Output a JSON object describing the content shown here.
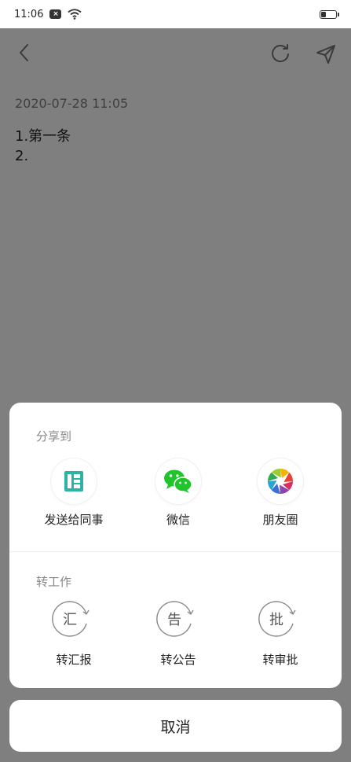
{
  "status_bar": {
    "time": "11:06",
    "notif_badge": "×"
  },
  "note": {
    "timestamp": "2020-07-28 11:05",
    "lines": [
      "1.第一条",
      "2."
    ]
  },
  "share_sheet": {
    "share_section_title": "分享到",
    "share_items": [
      {
        "label": "发送给同事",
        "icon": "send-to-colleague-icon"
      },
      {
        "label": "微信",
        "icon": "wechat-icon"
      },
      {
        "label": "朋友圈",
        "icon": "moments-icon"
      }
    ],
    "work_section_title": "转工作",
    "work_items": [
      {
        "label": "转汇报",
        "glyph": "汇",
        "icon": "to-report-icon"
      },
      {
        "label": "转公告",
        "glyph": "告",
        "icon": "to-announcement-icon"
      },
      {
        "label": "转审批",
        "glyph": "批",
        "icon": "to-approval-icon"
      }
    ]
  },
  "cancel_label": "取消",
  "colors": {
    "overlay": "#7f7f7f",
    "wechat_green": "#20c52c",
    "teal": "#2bb3a3"
  }
}
